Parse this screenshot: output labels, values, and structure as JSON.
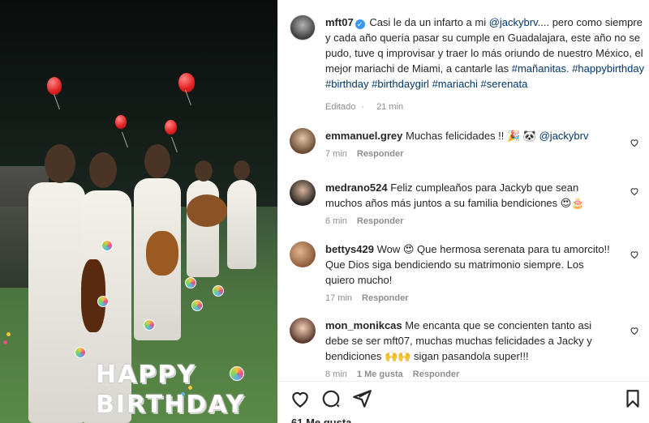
{
  "post": {
    "author": "mft07",
    "caption_parts": [
      {
        "text": "Casi le da un infarto a mi ",
        "tag": false
      },
      {
        "text": "@jackybrv",
        "tag": true
      },
      {
        "text": ".... pero como siempre y cada año quería pasar su cumple en Guadalajara, este año no se pudo, tuve q improvisar y traer lo más oriundo de nuestro México, el mejor mariachi de Miami, a cantarle las ",
        "tag": false
      },
      {
        "text": "#mañanitas",
        "tag": true
      },
      {
        "text": ". ",
        "tag": false
      },
      {
        "text": "#happybirthday",
        "tag": true
      },
      {
        "text": " ",
        "tag": false
      },
      {
        "text": "#birthday",
        "tag": true
      },
      {
        "text": " ",
        "tag": false
      },
      {
        "text": "#birthdaygirl",
        "tag": true
      },
      {
        "text": " ",
        "tag": false
      },
      {
        "text": "#mariachi",
        "tag": true
      },
      {
        "text": " ",
        "tag": false
      },
      {
        "text": "#serenata",
        "tag": true
      }
    ],
    "edited_label": "Editado",
    "time": "21 min"
  },
  "media_overlay": {
    "line1": "HAPPY",
    "line2": "BIRTHDAY"
  },
  "comments": [
    {
      "user": "emmanuel.grey",
      "text": "Muchas felicidades !! 🎉 🐼 ",
      "mention": "@jackybrv",
      "time": "7 min",
      "likes": "",
      "reply": "Responder"
    },
    {
      "user": "medrano524",
      "text": "Feliz cumpleaños para Jackyb que sean muchos años más juntos a su familia bendiciones 😍🎂",
      "mention": "",
      "time": "6 min",
      "likes": "",
      "reply": "Responder"
    },
    {
      "user": "bettys429",
      "text": "Wow 😍 Que hermosa serenata para tu amorcito!! Que Dios siga bendiciendo su matrimonio siempre. Los quiero mucho!",
      "mention": "",
      "time": "17 min",
      "likes": "",
      "reply": "Responder"
    },
    {
      "user": "mon_monikcas",
      "text": "Me encanta que se concienten tanto asi debe se ser mft07, muchas muchas felicidades a Jacky y bendiciones 🙌🙌 sigan pasandola super!!!",
      "mention": "",
      "time": "8 min",
      "likes": "1 Me gusta",
      "reply": "Responder"
    }
  ],
  "likes_count": "61 Me gusta",
  "icons": [
    "heart-icon",
    "comment-icon",
    "share-icon",
    "bookmark-icon"
  ]
}
